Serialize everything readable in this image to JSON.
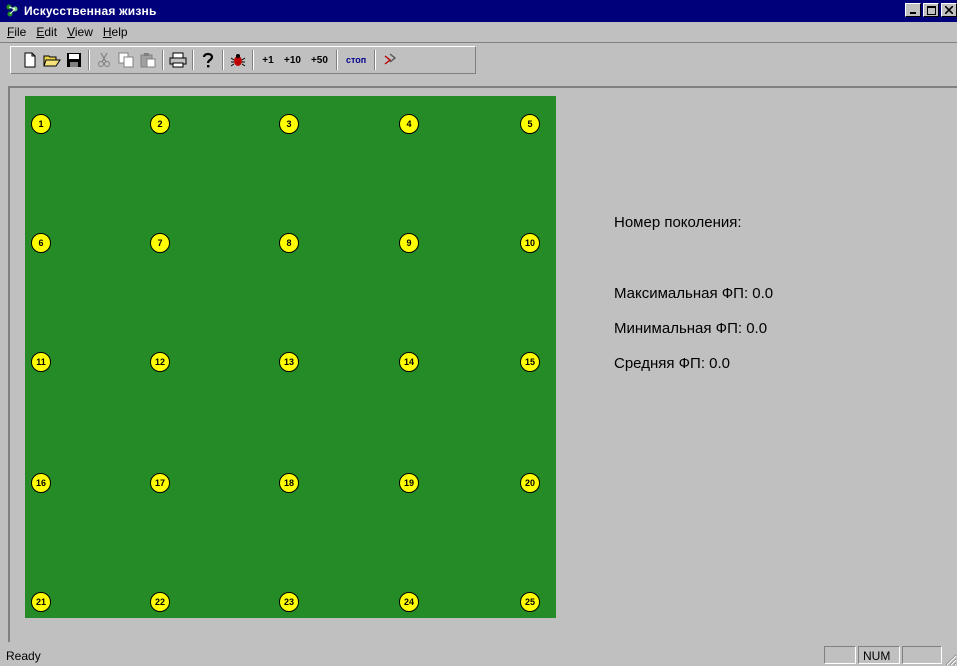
{
  "window": {
    "title": "Искусственная жизнь",
    "controls": [
      "minimize",
      "maximize",
      "close"
    ]
  },
  "menu": [
    {
      "label": "File",
      "accel": "F",
      "rest": "ile"
    },
    {
      "label": "Edit",
      "accel": "E",
      "rest": "dit"
    },
    {
      "label": "View",
      "accel": "V",
      "rest": "iew"
    },
    {
      "label": "Help",
      "accel": "H",
      "rest": "elp"
    }
  ],
  "toolbar": {
    "icons": [
      "new-file-icon",
      "open-folder-icon",
      "save-disk-icon",
      "cut-icon",
      "copy-icon",
      "paste-icon",
      "print-icon",
      "help-question-icon",
      "bug-icon",
      "step-arrows-icon"
    ],
    "step1": "+1",
    "step10": "+10",
    "step50": "+50",
    "stop": "стоп"
  },
  "grid": {
    "background": "#258b27",
    "cell_color": "#ffff00",
    "rows": 5,
    "cols": 5,
    "cells": [
      "1",
      "2",
      "3",
      "4",
      "5",
      "6",
      "7",
      "8",
      "9",
      "10",
      "11",
      "12",
      "13",
      "14",
      "15",
      "16",
      "17",
      "18",
      "19",
      "20",
      "21",
      "22",
      "23",
      "24",
      "25"
    ]
  },
  "stats": {
    "generation": "Номер поколения:",
    "max": "Максимальная ФП: 0.0",
    "min": "Минимальная ФП: 0.0",
    "avg": "Средняя ФП: 0.0"
  },
  "status": {
    "text": "Ready",
    "num": "NUM"
  }
}
